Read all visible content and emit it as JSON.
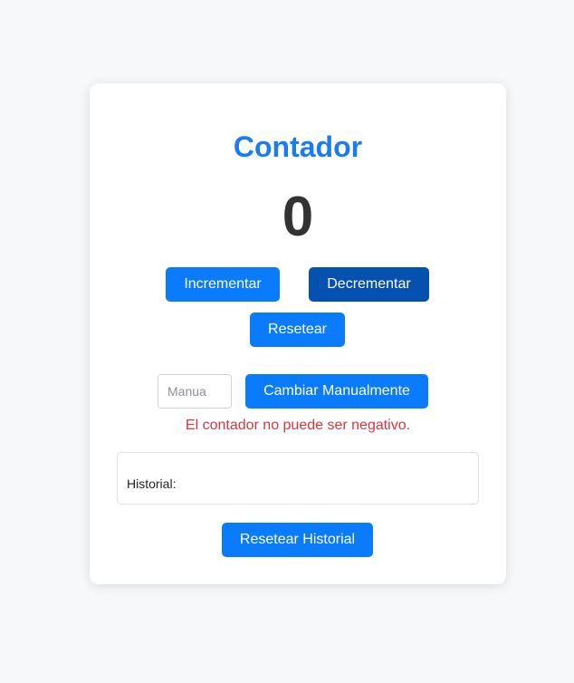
{
  "title": "Contador",
  "counter_value": "0",
  "buttons": {
    "increment": "Incrementar",
    "decrement": "Decrementar",
    "reset": "Resetear",
    "change_manual": "Cambiar Manualmente",
    "reset_history": "Resetear Historial"
  },
  "manual_input": {
    "placeholder": "Manua",
    "value": ""
  },
  "error_message": "El contador no puede ser negativo.",
  "history": {
    "label": "Historial:"
  },
  "colors": {
    "accent": "#0a7bfb",
    "accent_dark": "#0451b0",
    "title": "#1a7cf0",
    "error": "#d9363e"
  }
}
